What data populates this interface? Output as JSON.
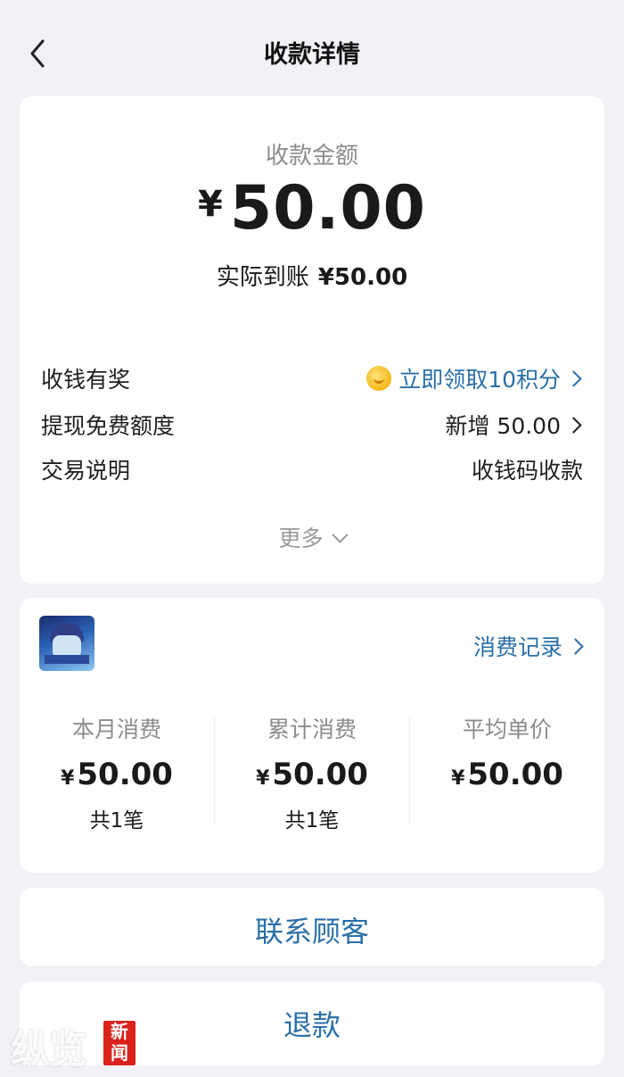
{
  "header": {
    "title": "收款详情"
  },
  "payment": {
    "amount_label": "收款金额",
    "currency": "¥",
    "amount": "50.00",
    "received_label": "实际到账",
    "received_value": "¥50.00"
  },
  "details": [
    {
      "key": "收钱有奖",
      "value": "立即领取10积分",
      "icon": "coin-icon",
      "arrow": true
    },
    {
      "key": "提现免费额度",
      "value": "新增 50.00",
      "arrow": true
    },
    {
      "key": "交易说明",
      "value": "收钱码收款",
      "arrow": false
    }
  ],
  "more_label": "更多",
  "customer": {
    "records_label": "消费记录",
    "stats": [
      {
        "label": "本月消费",
        "currency": "¥",
        "amount": "50.00",
        "count": "共1笔"
      },
      {
        "label": "累计消费",
        "currency": "¥",
        "amount": "50.00",
        "count": "共1笔"
      },
      {
        "label": "平均单价",
        "currency": "¥",
        "amount": "50.00",
        "count": ""
      }
    ]
  },
  "actions": {
    "contact": "联系顾客",
    "refund": "退款"
  },
  "watermark": {
    "text": "纵览",
    "stamp": "新闻"
  },
  "colors": {
    "link": "#2a6fa8",
    "background": "#f1f2f6",
    "stamp": "#d9221c"
  }
}
